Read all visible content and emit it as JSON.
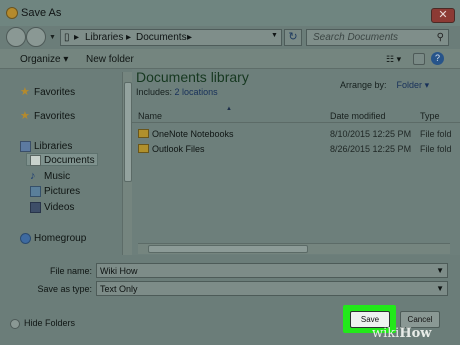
{
  "window": {
    "title": "Save As"
  },
  "address": {
    "crumbs": [
      "Libraries",
      "Documents"
    ]
  },
  "search": {
    "placeholder": "Search Documents"
  },
  "toolbar": {
    "organize": "Organize",
    "new_folder": "New folder"
  },
  "nav": {
    "items": [
      {
        "label": "Favorites",
        "icon": "star-icon"
      },
      {
        "label": "Favorites",
        "icon": "star-icon"
      },
      {
        "label": "Libraries",
        "icon": "libraries-icon"
      },
      {
        "label": "Documents",
        "icon": "documents-icon"
      },
      {
        "label": "Music",
        "icon": "music-icon"
      },
      {
        "label": "Pictures",
        "icon": "pictures-icon"
      },
      {
        "label": "Videos",
        "icon": "videos-icon"
      },
      {
        "label": "Homegroup",
        "icon": "homegroup-icon"
      }
    ]
  },
  "library": {
    "title": "Documents library",
    "includes_label": "Includes:",
    "includes_link": "2 locations",
    "arrange_label": "Arrange by:",
    "arrange_value": "Folder"
  },
  "columns": {
    "name": "Name",
    "date": "Date modified",
    "type": "Type"
  },
  "files": [
    {
      "name": "OneNote Notebooks",
      "date": "8/10/2015 12:25 PM",
      "type": "File fold"
    },
    {
      "name": "Outlook Files",
      "date": "8/26/2015 12:25 PM",
      "type": "File fold"
    }
  ],
  "form": {
    "filename_label": "File name:",
    "filename_value": "Wiki How",
    "type_label": "Save as type:",
    "type_value": "Text Only"
  },
  "footer": {
    "hide_folders": "Hide Folders",
    "save": "Save",
    "cancel": "Cancel"
  },
  "watermark": {
    "part1": "wiki",
    "part2": "How"
  },
  "colors": {
    "highlight": "#22e81a",
    "library_title": "#163820",
    "link": "#17305a"
  }
}
